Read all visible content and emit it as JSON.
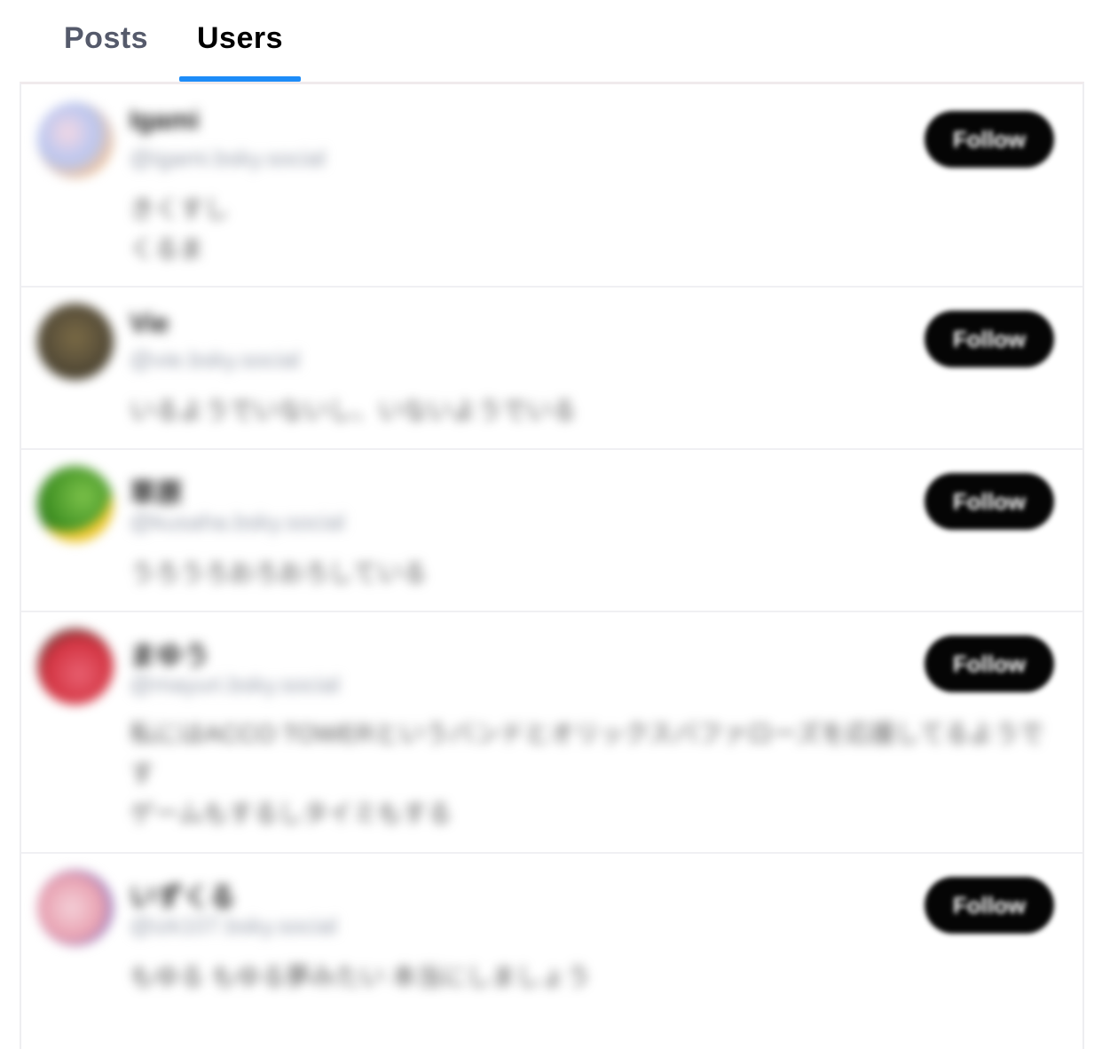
{
  "tabs": [
    {
      "label": "Posts",
      "active": false
    },
    {
      "label": "Users",
      "active": true
    }
  ],
  "accent_color": "#1d8cf8",
  "users": [
    {
      "display_name": "Igami",
      "handle": "@igami.bsky.social",
      "bio": "きくすし\nくるま",
      "avatar_colors": [
        "#f3d8e4",
        "#b9c6f0",
        "#f0c39a"
      ],
      "follow_label": "Follow"
    },
    {
      "display_name": "Vie",
      "handle": "@vie.bsky.social",
      "bio": "いるようでいないし、いないようでいる",
      "avatar_colors": [
        "#3a3322",
        "#7a6a45",
        "#5a503a"
      ],
      "follow_label": "Follow"
    },
    {
      "display_name": "草原",
      "handle": "@kusaha.bsky.social",
      "bio": "うろうろおろおろしている",
      "avatar_colors": [
        "#3e8f22",
        "#7cc24a",
        "#f0c830"
      ],
      "follow_label": "Follow"
    },
    {
      "display_name": "まゆう",
      "handle": "@mayuri.bsky.social",
      "bio": "私にはACCO TOWERというバンドとオリックスバファローズを応援してるようです\nゲームもするしタイミもする",
      "avatar_colors": [
        "#d23240",
        "#2a4a3a",
        "#e86070"
      ],
      "follow_label": "Follow"
    },
    {
      "display_name": "いずくる",
      "handle": "@izk107.bsky.social",
      "bio": "もゆる もゆる夢みたい 本当にしましょう",
      "avatar_colors": [
        "#e8a0b0",
        "#4a5ad0",
        "#f4d0d8"
      ],
      "follow_label": "Follow"
    }
  ]
}
